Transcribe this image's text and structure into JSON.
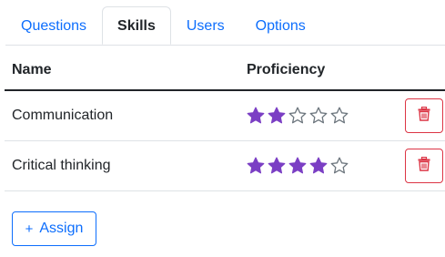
{
  "tabs": [
    {
      "label": "Questions",
      "active": false
    },
    {
      "label": "Skills",
      "active": true
    },
    {
      "label": "Users",
      "active": false
    },
    {
      "label": "Options",
      "active": false
    }
  ],
  "table": {
    "headers": {
      "name": "Name",
      "proficiency": "Proficiency"
    },
    "rows": [
      {
        "name": "Communication",
        "proficiency": 2,
        "max": 5
      },
      {
        "name": "Critical thinking",
        "proficiency": 4,
        "max": 5
      }
    ]
  },
  "assign_button": {
    "icon": "+",
    "label": "Assign"
  },
  "colors": {
    "accent": "#0d6efd",
    "star": "#7b3fc4",
    "danger": "#dc3545"
  },
  "icons": {
    "filled": "star-filled-icon",
    "empty": "star-outline-icon",
    "delete": "trash-icon"
  }
}
